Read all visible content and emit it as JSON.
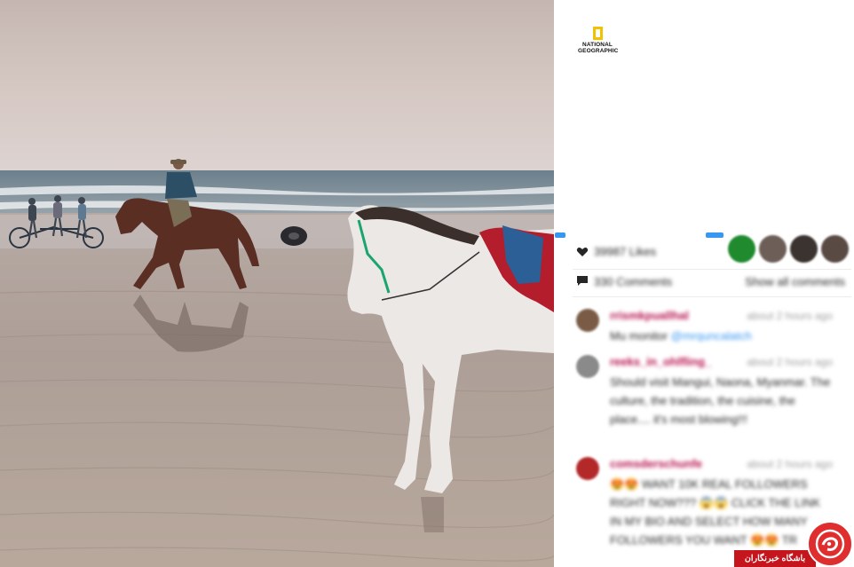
{
  "post": {
    "image_alt": "Horses and riders on a wet beach at sunset",
    "publisher": {
      "logo_lines": [
        "NATIONAL",
        "GEOGRAPHIC"
      ]
    },
    "likes_text": "39987 Likes",
    "comments_text": "330 Comments",
    "show_all_label": "Show all comments",
    "liker_avatar_colors": [
      "#1f8a2e",
      "#6d5e58",
      "#3a3330",
      "#5a4a44"
    ]
  },
  "comments": [
    {
      "username": "rrismkpuallhal",
      "time": "about 2 hours ago",
      "text_prefix": "Mu monitor ",
      "mention": "@mrquncalatch",
      "text_suffix": "",
      "avatar_color": "#7a5c46"
    },
    {
      "username": "reeks_in_ohlfling_",
      "time": "about 2 hours ago",
      "text_prefix": "Should visit Mangui, Naona, Myanmar. The culture, the tradition, the cuisine, the place.... it's most blowing!!!",
      "mention": "",
      "text_suffix": "",
      "avatar_color": "#8a8a8a"
    },
    {
      "username": "comsderschunfe",
      "time": "about 2 hours ago",
      "text_prefix": "😍😍 WANT 10K REAL FOLLOWERS RIGHT NOW??? 😱😱 CLICK THE LINK IN MY BIO AND SELECT HOW MANY FOLLOWERS YOU WANT 😍😍 TR",
      "mention": "",
      "text_suffix": "",
      "avatar_color": "#b32828"
    }
  ],
  "watermark": {
    "text": "باشگاه خبرنگاران",
    "color": "#c4161c"
  }
}
